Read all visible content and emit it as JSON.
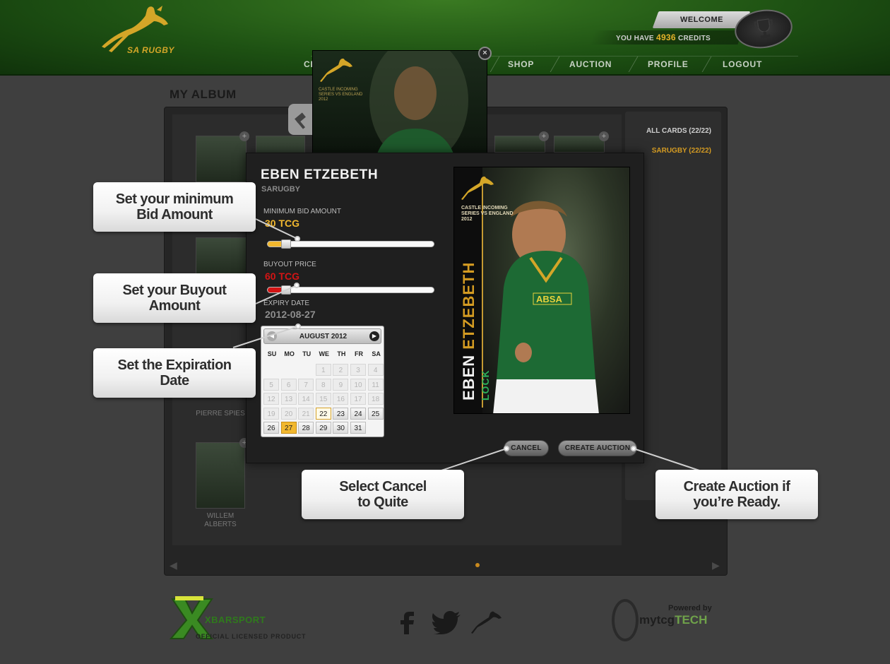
{
  "header": {
    "logo_text": "SA RUGBY",
    "welcome_label": "WELCOME",
    "credits_prefix": "YOU HAVE",
    "credits_value": "4936",
    "credits_suffix": "CREDITS",
    "nav": [
      "CR",
      "SHOP",
      "AUCTION",
      "PROFILE",
      "LOGOUT"
    ]
  },
  "album": {
    "title": "MY ALBUM",
    "filters": [
      "ALL CARDS (22/22)",
      "SARUGBY (22/22)"
    ],
    "labels": [
      "PIERRE SPIES",
      "WILLEM\nALBERTS"
    ],
    "prev_arrow": "◀",
    "next_arrow": "▶"
  },
  "preview_card": {
    "series": "CASTLE INCOMING SERIES VS ENGLAND 2012",
    "close": "×"
  },
  "modal": {
    "player_name": "EBEN ETZEBETH",
    "team": "SARUGBY",
    "min_bid_label": "MINIMUM BID AMOUNT",
    "min_bid_value": "30 TCG",
    "min_bid_fraction": 0.07,
    "buyout_label": "BUYOUT PRICE",
    "buyout_value": "60 TCG",
    "buyout_fraction": 0.07,
    "expiry_label": "EXPIRY DATE",
    "expiry_value": "2012-08-27",
    "cancel_label": "CANCEL",
    "create_label": "CREATE AUCTION"
  },
  "calendar": {
    "month_label": "AUGUST 2012",
    "days_of_week": [
      "SU",
      "MO",
      "TU",
      "WE",
      "TH",
      "FR",
      "SA"
    ],
    "weeks": [
      [
        "",
        "",
        "",
        "1",
        "2",
        "3",
        "4"
      ],
      [
        "5",
        "6",
        "7",
        "8",
        "9",
        "10",
        "11"
      ],
      [
        "12",
        "13",
        "14",
        "15",
        "16",
        "17",
        "18"
      ],
      [
        "19",
        "20",
        "21",
        "22",
        "23",
        "24",
        "25"
      ],
      [
        "26",
        "27",
        "28",
        "29",
        "30",
        "31",
        ""
      ]
    ],
    "today": "22",
    "selected": "27",
    "first_available": 22
  },
  "card": {
    "series": "CASTLE INCOMING SERIES VS ENGLAND 2012",
    "first_name": "EBEN",
    "last_name": "ETZEBETH",
    "position": "LOCK",
    "brand": "SA RUGBY"
  },
  "tooltips": {
    "min_bid": "Set your minimum\nBid Amount",
    "buyout": "Set your Buyout\nAmount",
    "expiry": "Set the Expiration\nDate",
    "cancel": "Select Cancel\nto Quite",
    "create": "Create Auction if\nyou’re Ready."
  },
  "footer": {
    "xbar": "XBARSPORT",
    "licensed": "OFFICIAL LICENSED PRODUCT",
    "powered": "Powered by",
    "mytcg": "mytcg",
    "mytcg_accent": "TECH"
  },
  "colors": {
    "gold": "#f2b82f",
    "red": "#d41414",
    "green_header": "#1e5213"
  }
}
